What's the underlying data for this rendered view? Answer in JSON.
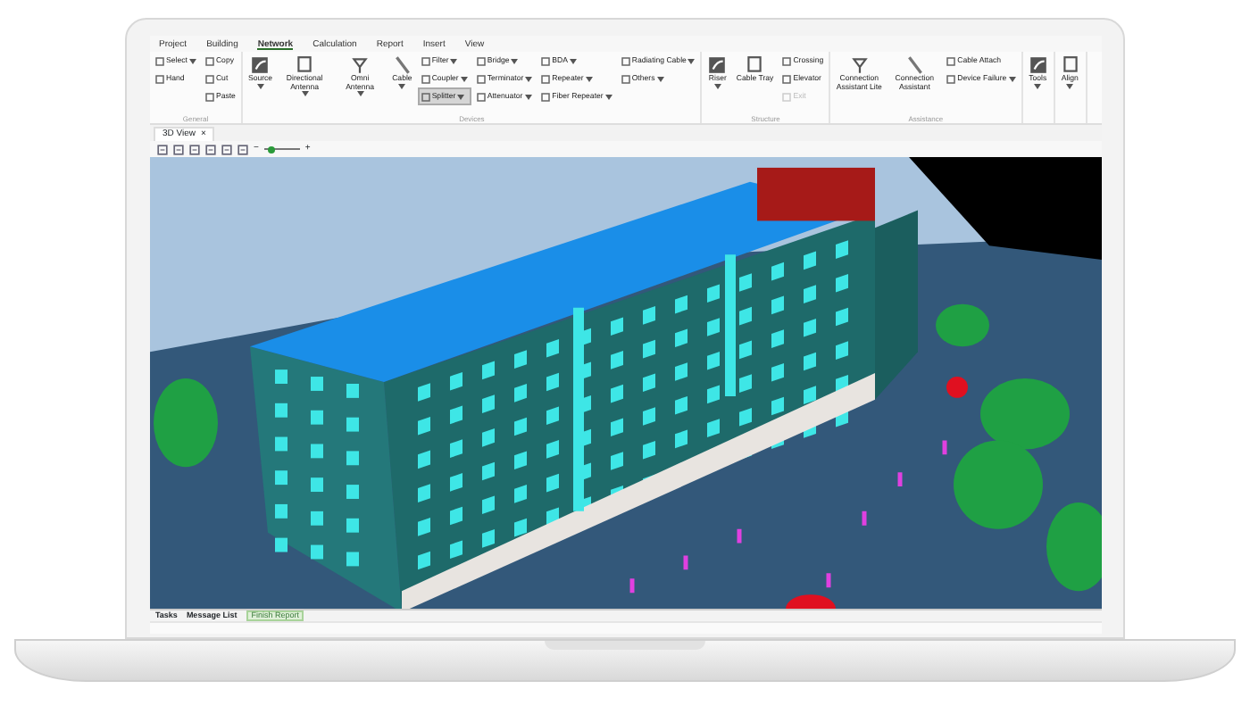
{
  "menu_tabs": [
    {
      "label": "Project",
      "selected": false
    },
    {
      "label": "Building",
      "selected": false
    },
    {
      "label": "Network",
      "selected": true
    },
    {
      "label": "Calculation",
      "selected": false
    },
    {
      "label": "Report",
      "selected": false
    },
    {
      "label": "Insert",
      "selected": false
    },
    {
      "label": "View",
      "selected": false
    }
  ],
  "ribbon": [
    {
      "label": "General",
      "columns": [
        [
          {
            "label": "Select",
            "kind": "small",
            "dropdown": true,
            "selected": false,
            "disabled": false
          },
          {
            "label": "Hand",
            "kind": "small",
            "dropdown": false,
            "selected": false,
            "disabled": false
          }
        ],
        [
          {
            "label": "Copy",
            "kind": "small",
            "dropdown": false,
            "selected": false,
            "disabled": false
          },
          {
            "label": "Cut",
            "kind": "small",
            "dropdown": false,
            "selected": false,
            "disabled": false
          },
          {
            "label": "Paste",
            "kind": "small",
            "dropdown": false,
            "selected": false,
            "disabled": false
          }
        ]
      ]
    },
    {
      "label": "Devices",
      "columns": [
        [
          {
            "label": "Source",
            "kind": "large",
            "dropdown": true,
            "selected": false,
            "disabled": false
          }
        ],
        [
          {
            "label": "Directional Antenna",
            "kind": "large",
            "dropdown": true,
            "selected": false,
            "disabled": false
          }
        ],
        [
          {
            "label": "Omni Antenna",
            "kind": "large",
            "dropdown": true,
            "selected": false,
            "disabled": false
          }
        ],
        [
          {
            "label": "Cable",
            "kind": "large",
            "dropdown": true,
            "selected": false,
            "disabled": false
          }
        ],
        [
          {
            "label": "Filter",
            "kind": "small",
            "dropdown": true,
            "selected": false,
            "disabled": false
          },
          {
            "label": "Coupler",
            "kind": "small",
            "dropdown": true,
            "selected": false,
            "disabled": false
          },
          {
            "label": "Splitter",
            "kind": "small",
            "dropdown": true,
            "selected": true,
            "disabled": false
          }
        ],
        [
          {
            "label": "Bridge",
            "kind": "small",
            "dropdown": true,
            "selected": false,
            "disabled": false
          },
          {
            "label": "Terminator",
            "kind": "small",
            "dropdown": true,
            "selected": false,
            "disabled": false
          },
          {
            "label": "Attenuator",
            "kind": "small",
            "dropdown": true,
            "selected": false,
            "disabled": false
          }
        ],
        [
          {
            "label": "BDA",
            "kind": "small",
            "dropdown": true,
            "selected": false,
            "disabled": false
          },
          {
            "label": "Repeater",
            "kind": "small",
            "dropdown": true,
            "selected": false,
            "disabled": false
          },
          {
            "label": "Fiber Repeater",
            "kind": "small",
            "dropdown": true,
            "selected": false,
            "disabled": false
          }
        ],
        [
          {
            "label": "Radiating Cable",
            "kind": "small",
            "dropdown": true,
            "selected": false,
            "disabled": false
          },
          {
            "label": "Others",
            "kind": "small",
            "dropdown": true,
            "selected": false,
            "disabled": false
          }
        ]
      ]
    },
    {
      "label": "Structure",
      "columns": [
        [
          {
            "label": "Riser",
            "kind": "large",
            "dropdown": true,
            "selected": false,
            "disabled": false
          }
        ],
        [
          {
            "label": "Cable Tray",
            "kind": "large",
            "dropdown": false,
            "selected": false,
            "disabled": false
          }
        ],
        [
          {
            "label": "Crossing",
            "kind": "small",
            "dropdown": false,
            "selected": false,
            "disabled": false
          },
          {
            "label": "Elevator",
            "kind": "small",
            "dropdown": false,
            "selected": false,
            "disabled": false
          },
          {
            "label": "Exit",
            "kind": "small",
            "dropdown": false,
            "selected": false,
            "disabled": true
          }
        ]
      ]
    },
    {
      "label": "Assistance",
      "columns": [
        [
          {
            "label": "Connection Assistant Lite",
            "kind": "large",
            "dropdown": false,
            "selected": false,
            "disabled": false
          }
        ],
        [
          {
            "label": "Connection Assistant",
            "kind": "large",
            "dropdown": false,
            "selected": false,
            "disabled": false
          }
        ],
        [
          {
            "label": "Cable Attach",
            "kind": "small",
            "dropdown": false,
            "selected": false,
            "disabled": false
          },
          {
            "label": "Device Failure",
            "kind": "small",
            "dropdown": true,
            "selected": false,
            "disabled": false
          }
        ]
      ]
    },
    {
      "columns": [
        [
          {
            "label": "Tools",
            "kind": "large",
            "dropdown": true,
            "selected": false,
            "disabled": false
          }
        ]
      ]
    },
    {
      "columns": [
        [
          {
            "label": "Align",
            "kind": "large",
            "dropdown": true,
            "selected": false,
            "disabled": false
          }
        ]
      ]
    }
  ],
  "document_tab": {
    "label": "3D View",
    "close": "×"
  },
  "view_toolbar": {
    "zoom_out": "−",
    "zoom_in": "+",
    "zoom": {
      "level": 0.1
    }
  },
  "bottom_panel": {
    "tabs": [
      {
        "label": "Tasks"
      },
      {
        "label": "Message List"
      }
    ],
    "finish_button": "Finish Report"
  }
}
